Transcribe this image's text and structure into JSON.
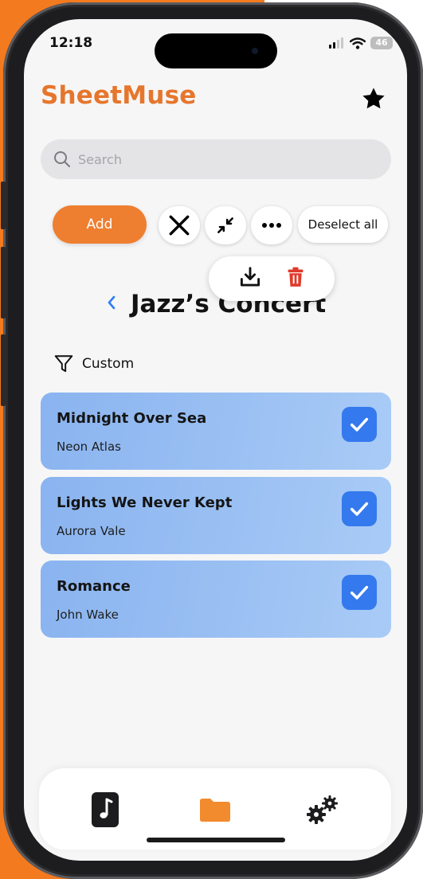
{
  "status_bar": {
    "time": "12:18",
    "battery": "46"
  },
  "app": {
    "title": "SheetMuse"
  },
  "search": {
    "placeholder": "Search"
  },
  "toolbar": {
    "add_label": "Add",
    "deselect_label": "Deselect all"
  },
  "playlist": {
    "title": "Jazz’s Concert"
  },
  "filter": {
    "label": "Custom"
  },
  "songs": [
    {
      "title": "Midnight Over Sea",
      "artist": "Neon Atlas",
      "selected": true
    },
    {
      "title": "Lights We Never Kept",
      "artist": "Aurora Vale",
      "selected": true
    },
    {
      "title": "Romance",
      "artist": "John Wake",
      "selected": true
    }
  ],
  "icons": {
    "star": "star-icon",
    "search": "search-icon",
    "close": "close-icon",
    "collapse": "collapse-icon",
    "more": "more-icon",
    "download": "download-icon",
    "trash": "trash-icon",
    "back": "chevron-left-icon",
    "filter": "filter-icon",
    "check": "checkmark-icon",
    "tabs": [
      "music-note-icon",
      "folder-icon",
      "gears-icon"
    ]
  },
  "colors": {
    "brand": "#e6762c",
    "add_button": "#ee7f30",
    "accent_blue": "#3479ee",
    "song_card": "#94baf2",
    "delete_red": "#e03a2c",
    "background_orange": "#f47a20"
  }
}
